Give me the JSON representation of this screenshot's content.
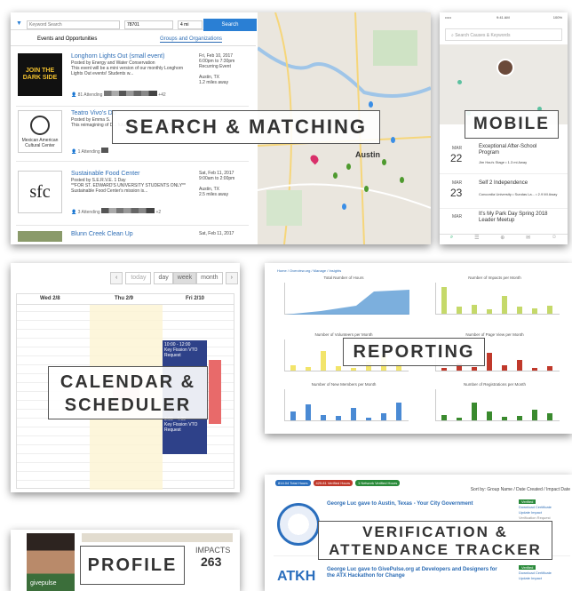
{
  "labels": {
    "search": "SEARCH & MATCHING",
    "mobile": "MOBILE",
    "calendar": "CALENDAR & SCHEDULER",
    "reporting": "REPORTING",
    "verify": "VERIFICATION & ATTENDANCE TRACKER",
    "profile": "PROFILE"
  },
  "search": {
    "keyword_placeholder": "Keyword Search",
    "zip": "78701",
    "radius": "4 mi",
    "button": "Search",
    "tabs": [
      "Events and Opportunities",
      "Groups and Organizations"
    ],
    "events": [
      {
        "title": "Longhorn Lights Out (small event)",
        "posted": "Posted by Energy and Water Conservation",
        "desc": "This event will be a mini version of our monthly Longhorn Lights Out events! Students w...",
        "date": "Fri, Feb 10, 2017",
        "time": "6:00pm to 7:30pm",
        "recur": "Recurring Event",
        "city": "Austin, TX",
        "dist": "1.2 miles away",
        "going": "81",
        "more": "+42",
        "logo": "JOIN THE DARK SIDE"
      },
      {
        "title": "Teatro Vivo's Do",
        "posted": "Posted by Emma S.",
        "desc": "This reimagining of D... future bordered between Mexico",
        "date": "",
        "time": "",
        "recur": "",
        "city": "",
        "dist": "",
        "going": "1",
        "more": "",
        "logo": "Mexican American Cultural Center"
      },
      {
        "title": "Sustainable Food Center",
        "posted": "Posted by S.E.R.V.E. 1 Day",
        "desc": "**FOR ST. EDWARD'S UNIVERSITY STUDENTS ONLY** Sustainable Food Center's mission is...",
        "date": "Sat, Feb 11, 2017",
        "time": "9:00am to 2:00pm",
        "recur": "",
        "city": "Austin, TX",
        "dist": "2.5 miles away",
        "going": "3",
        "more": "+2",
        "logo": "sfc"
      },
      {
        "title": "Blunn Creek Clean Up",
        "posted": "",
        "desc": "",
        "date": "Sat, Feb 11, 2017",
        "time": "",
        "recur": "",
        "city": "",
        "dist": "",
        "going": "",
        "more": "",
        "logo": ""
      }
    ],
    "map_city": "Austin"
  },
  "mobile": {
    "time": "9:41 AM",
    "battery": "100%",
    "search": "Search Causes & Keywords",
    "events": [
      {
        "mon": "MAR",
        "day": "22",
        "title": "Exceptional After-School Program",
        "sub": "Jim Hau's Stage • 1.3 mi Away"
      },
      {
        "mon": "MAR",
        "day": "23",
        "title": "Self 2 Independence",
        "sub": "Concordia University • Sundas La... • 2.9 MI Away"
      },
      {
        "mon": "MAR",
        "day": "",
        "title": "It's My Park Day Spring 2018 Leader Meetup",
        "sub": ""
      }
    ]
  },
  "calendar": {
    "today": "today",
    "views": [
      "day",
      "week",
      "month"
    ],
    "cols": [
      "Wed 2/8",
      "Thu 2/9",
      "Fri 2/10"
    ],
    "event": {
      "time": "10:00 - 12:00",
      "title": "Key Fission VTO Request"
    },
    "event2": {
      "time": "3:00 - 4:00",
      "title": "Key Fission VTO Request"
    }
  },
  "reporting": {
    "breadcrumb": "Home / Overview.org / Manage / Insights",
    "charts": [
      "Total Number of Hours",
      "Number of Impacts per Month",
      "Number of Volunteers per Month",
      "Number of Page View per Month",
      "Number of New Members per Month",
      "Number of Registrations per Month"
    ]
  },
  "verify": {
    "badges": [
      "814.04 Total Hours",
      "425.81 Verified Hours",
      "1 Network Verified Hours"
    ],
    "sortby": "Sort by: Group Name / Date Created / Impact Date",
    "items": [
      {
        "title": "George Luc gave to Austin, Texas - Your City Government",
        "status": "Verified",
        "actions": [
          "Download Certificate",
          "Update Impact",
          "Verification Request"
        ]
      },
      {
        "title": "George Luc gave to GivePulse.org at Developers and Designers for the ATX Hackathon for Change",
        "status": "Verified",
        "actions": [
          "Download Certificate",
          "Update Impact"
        ]
      }
    ]
  },
  "profile": {
    "impacts_label": "IMPACTS",
    "impacts": "263",
    "watermark": "givepulse"
  }
}
